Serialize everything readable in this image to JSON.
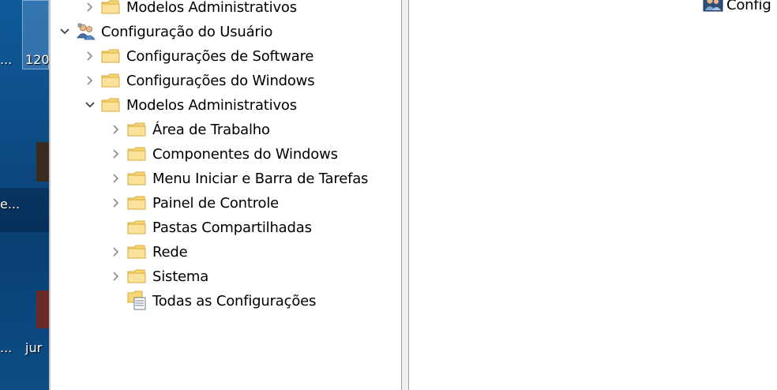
{
  "desktop": {
    "labels": [
      "...",
      "120",
      "e...",
      "...",
      "jur"
    ]
  },
  "tree": {
    "items": [
      {
        "label": "Modelos Administrativos",
        "expanded": false
      },
      {
        "label": "Configuração do Usuário",
        "expanded": true
      },
      {
        "label": "Configurações de Software",
        "expanded": false
      },
      {
        "label": "Configurações do Windows",
        "expanded": false
      },
      {
        "label": "Modelos Administrativos",
        "expanded": true
      },
      {
        "label": "Área de Trabalho",
        "expanded": false
      },
      {
        "label": "Componentes do Windows",
        "expanded": false
      },
      {
        "label": "Menu Iniciar e Barra de Tarefas",
        "expanded": false
      },
      {
        "label": "Painel de Controle",
        "expanded": false
      },
      {
        "label": "Pastas Compartilhadas",
        "expanded": false
      },
      {
        "label": "Rede",
        "expanded": false
      },
      {
        "label": "Sistema",
        "expanded": false
      },
      {
        "label": "Todas as Configurações",
        "expanded": false
      }
    ]
  },
  "right_pane": {
    "item_label": "Config"
  },
  "colors": {
    "folder_fill": "#f8d775",
    "folder_edge": "#d9a93c",
    "chevron": "#8a8a8a",
    "chevron_expanded": "#404040"
  }
}
